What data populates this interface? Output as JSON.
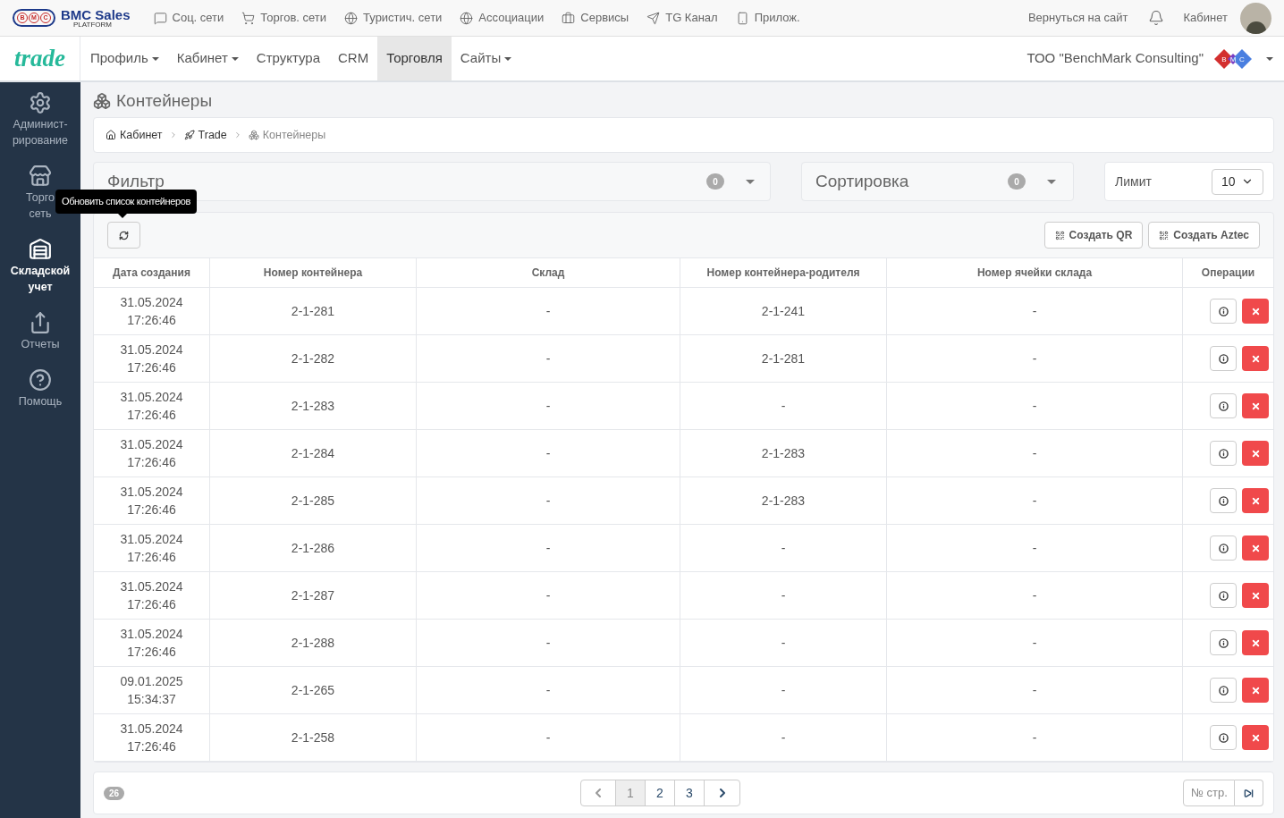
{
  "topbar": {
    "brand": "BMC Sales",
    "brand_sub": "PLATFORM",
    "logo_letters": [
      "B",
      "M",
      "C"
    ],
    "links": [
      {
        "label": "Соц. сети"
      },
      {
        "label": "Торгов. сети"
      },
      {
        "label": "Туристич. сети"
      },
      {
        "label": "Ассоциации"
      },
      {
        "label": "Сервисы"
      },
      {
        "label": "TG Канал"
      },
      {
        "label": "Прилож."
      }
    ],
    "back_link": "Вернуться на сайт",
    "account": "Кабинет"
  },
  "navbar": {
    "logo": "trade",
    "items": [
      {
        "label": "Профиль",
        "dropdown": true,
        "selected": false
      },
      {
        "label": "Кабинет",
        "dropdown": true,
        "selected": false
      },
      {
        "label": "Структура",
        "dropdown": false,
        "selected": false
      },
      {
        "label": "CRM",
        "dropdown": false,
        "selected": false
      },
      {
        "label": "Торговля",
        "dropdown": false,
        "selected": true
      },
      {
        "label": "Сайты",
        "dropdown": true,
        "selected": false
      }
    ],
    "company": "ТОО \"BenchMark Consulting\"",
    "company_logo_letters": [
      "B",
      "M",
      "C"
    ]
  },
  "sidebar": {
    "items": [
      {
        "lines": [
          "Админист-",
          "рирование"
        ],
        "selected": false
      },
      {
        "lines": [
          "Торго",
          "сеть"
        ],
        "selected": false
      },
      {
        "lines": [
          "Складской",
          "учет"
        ],
        "selected": true
      },
      {
        "lines": [
          "Отчеты"
        ],
        "selected": false
      },
      {
        "lines": [
          "Помощь"
        ],
        "selected": false
      }
    ]
  },
  "page_title": "Контейнеры",
  "breadcrumbs": [
    {
      "label": "Кабинет"
    },
    {
      "label": "Trade"
    },
    {
      "label": "Контейнеры"
    }
  ],
  "filter": {
    "title": "Фильтр",
    "count": "0"
  },
  "sort": {
    "title": "Сортировка",
    "count": "0"
  },
  "limit": {
    "label": "Лимит",
    "value": "10"
  },
  "tooltip": "Обновить список контейнеров",
  "actions": [
    "Создать QR",
    "Создать Aztec"
  ],
  "table": {
    "columns": [
      "Дата создания",
      "Номер контейнера",
      "Склад",
      "Номер контейнера-родителя",
      "Номер ячейки склада",
      "Операции"
    ],
    "rows": [
      {
        "date": "31.05.2024",
        "time": "17:26:46",
        "number": "2-1-281",
        "warehouse": "-",
        "parent": "2-1-241",
        "cell": "-"
      },
      {
        "date": "31.05.2024",
        "time": "17:26:46",
        "number": "2-1-282",
        "warehouse": "-",
        "parent": "2-1-281",
        "cell": "-"
      },
      {
        "date": "31.05.2024",
        "time": "17:26:46",
        "number": "2-1-283",
        "warehouse": "-",
        "parent": "-",
        "cell": "-"
      },
      {
        "date": "31.05.2024",
        "time": "17:26:46",
        "number": "2-1-284",
        "warehouse": "-",
        "parent": "2-1-283",
        "cell": "-"
      },
      {
        "date": "31.05.2024",
        "time": "17:26:46",
        "number": "2-1-285",
        "warehouse": "-",
        "parent": "2-1-283",
        "cell": "-"
      },
      {
        "date": "31.05.2024",
        "time": "17:26:46",
        "number": "2-1-286",
        "warehouse": "-",
        "parent": "-",
        "cell": "-"
      },
      {
        "date": "31.05.2024",
        "time": "17:26:46",
        "number": "2-1-287",
        "warehouse": "-",
        "parent": "-",
        "cell": "-"
      },
      {
        "date": "31.05.2024",
        "time": "17:26:46",
        "number": "2-1-288",
        "warehouse": "-",
        "parent": "-",
        "cell": "-"
      },
      {
        "date": "09.01.2025",
        "time": "15:34:37",
        "number": "2-1-265",
        "warehouse": "-",
        "parent": "-",
        "cell": "-"
      },
      {
        "date": "31.05.2024",
        "time": "17:26:46",
        "number": "2-1-258",
        "warehouse": "-",
        "parent": "-",
        "cell": "-"
      }
    ]
  },
  "pagination": {
    "total": "26",
    "pages": [
      {
        "label": "1",
        "selected": true
      },
      {
        "label": "2",
        "selected": false
      },
      {
        "label": "3",
        "selected": false
      }
    ],
    "page_field_placeholder": "№ стр."
  }
}
